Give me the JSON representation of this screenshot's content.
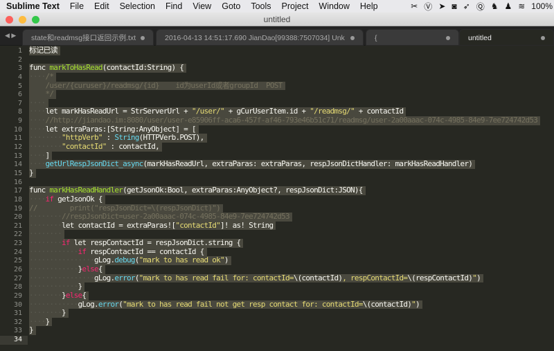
{
  "menubar": {
    "app": "Sublime Text",
    "items": [
      "File",
      "Edit",
      "Selection",
      "Find",
      "View",
      "Goto",
      "Tools",
      "Project",
      "Window",
      "Help"
    ],
    "battery": "100%",
    "tray_icons": [
      "scissors-icon",
      "vpn-icon",
      "arrow-icon",
      "camera-icon",
      "send-icon",
      "qq-browser-icon",
      "evernote-icon",
      "qq-icon",
      "wifi-icon"
    ]
  },
  "window": {
    "title": "untitled"
  },
  "tabs": [
    {
      "label": "state和readmsg接口返回示例.txt",
      "active": false
    },
    {
      "label": "2016-04-13 14:51:17.690 JianDao[99388:7507034] Unk",
      "active": false
    },
    {
      "label": "{",
      "active": false
    },
    {
      "label": "untitled",
      "active": true
    }
  ],
  "colors": {
    "background": "#272822",
    "keyword": "#f92672",
    "function": "#a6e22e",
    "string": "#e6db74",
    "comment": "#75715e",
    "builtin": "#66d9ef",
    "selection": "#49483e"
  },
  "editor": {
    "current_line": 34,
    "lines": [
      [
        [
          "p",
          "标记已读"
        ]
      ],
      [],
      [
        [
          "p",
          "func "
        ],
        [
          "f",
          "markToHasRead"
        ],
        [
          "p",
          "(contactId:String) {"
        ]
      ],
      [
        [
          "ws",
          "    "
        ],
        [
          "c",
          "/*"
        ]
      ],
      [
        [
          "c",
          "    /user/{curuser}/readmsg/{id}    id为userId或者groupId  POST"
        ]
      ],
      [
        [
          "c",
          "    */"
        ]
      ],
      [
        [
          "ws",
          "    "
        ]
      ],
      [
        [
          "ws",
          "    "
        ],
        [
          "p",
          "let markHasReadUrl = StrServerUrl + "
        ],
        [
          "s",
          "\"/user/\""
        ],
        [
          "p",
          " + gCurUserItem.id + "
        ],
        [
          "s",
          "\"/readmsg/\""
        ],
        [
          "p",
          " + contactId"
        ]
      ],
      [
        [
          "ws",
          "    "
        ],
        [
          "c",
          "//http://jiandao.im:8080/user/user-e85906ff-aca6-457f-af46-793e46b51c71/readmsg/user-2a00aaac-074c-4985-84e9-7ee724742d53"
        ]
      ],
      [
        [
          "ws",
          "    "
        ],
        [
          "p",
          "let extraParas:[String:AnyObject] = ["
        ]
      ],
      [
        [
          "ws",
          "        "
        ],
        [
          "s",
          "\"httpVerb\""
        ],
        [
          "p",
          " : "
        ],
        [
          "b",
          "String"
        ],
        [
          "p",
          "(HTTPVerb.POST),"
        ]
      ],
      [
        [
          "ws",
          "        "
        ],
        [
          "s",
          "\"contactId\""
        ],
        [
          "p",
          " : contactId,"
        ]
      ],
      [
        [
          "ws",
          "    "
        ],
        [
          "p",
          "]"
        ]
      ],
      [
        [
          "ws",
          "    "
        ],
        [
          "b",
          "getUrlRespJsonDict_async"
        ],
        [
          "p",
          "(markHasReadUrl, extraParas: extraParas, respJsonDictHandler: markHasReadHandler)"
        ]
      ],
      [
        [
          "p",
          "}"
        ]
      ],
      [],
      [
        [
          "p",
          "func "
        ],
        [
          "f",
          "markHasReadHandler"
        ],
        [
          "p",
          "(getJsonOk:Bool, extraParas:AnyObject?, respJsonDict:JSON){"
        ]
      ],
      [
        [
          "ws",
          "    "
        ],
        [
          "k",
          "if"
        ],
        [
          "p",
          " getJsonOk {"
        ]
      ],
      [
        [
          "c",
          "//        print(\"respJsonDict=\\(respJsonDict)\")"
        ]
      ],
      [
        [
          "ws",
          "        "
        ],
        [
          "c",
          "//respJsonDict=user-2a00aaac-074c-4985-84e9-7ee724742d53"
        ]
      ],
      [
        [
          "ws",
          "        "
        ],
        [
          "p",
          "let contactId = extraParas!["
        ],
        [
          "s",
          "\"contactId\""
        ],
        [
          "p",
          "]! as! String"
        ]
      ],
      [
        [
          "ws",
          "        "
        ]
      ],
      [
        [
          "ws",
          "        "
        ],
        [
          "k",
          "if"
        ],
        [
          "p",
          " let respContactId = respJsonDict.string {"
        ]
      ],
      [
        [
          "ws",
          "            "
        ],
        [
          "k",
          "if"
        ],
        [
          "p",
          " respContactId == contactId {"
        ]
      ],
      [
        [
          "ws",
          "                "
        ],
        [
          "p",
          "gLog."
        ],
        [
          "b",
          "debug"
        ],
        [
          "p",
          "("
        ],
        [
          "s",
          "\"mark to has read ok\""
        ],
        [
          "p",
          ")"
        ]
      ],
      [
        [
          "ws",
          "            "
        ],
        [
          "p",
          "}"
        ],
        [
          "k",
          "else"
        ],
        [
          "p",
          "{"
        ]
      ],
      [
        [
          "ws",
          "                "
        ],
        [
          "p",
          "gLog."
        ],
        [
          "b",
          "error"
        ],
        [
          "p",
          "("
        ],
        [
          "s",
          "\"mark to has read fail for: contactId="
        ],
        [
          "p",
          "\\(contactId)"
        ],
        [
          "s",
          ", respContactId="
        ],
        [
          "p",
          "\\(respContactId)"
        ],
        [
          "s",
          "\""
        ],
        [
          "p",
          ")"
        ]
      ],
      [
        [
          "ws",
          "            "
        ],
        [
          "p",
          "}"
        ]
      ],
      [
        [
          "ws",
          "        "
        ],
        [
          "p",
          "}"
        ],
        [
          "k",
          "else"
        ],
        [
          "p",
          "{"
        ]
      ],
      [
        [
          "ws",
          "            "
        ],
        [
          "p",
          "gLog."
        ],
        [
          "b",
          "error"
        ],
        [
          "p",
          "("
        ],
        [
          "s",
          "\"mark to has read fail not get resp contact for: contactId="
        ],
        [
          "p",
          "\\(contactId)"
        ],
        [
          "s",
          "\""
        ],
        [
          "p",
          ")"
        ]
      ],
      [
        [
          "ws",
          "        "
        ],
        [
          "p",
          "}"
        ]
      ],
      [
        [
          "ws",
          "    "
        ],
        [
          "p",
          "}"
        ]
      ],
      [
        [
          "p",
          "}"
        ]
      ],
      []
    ]
  }
}
